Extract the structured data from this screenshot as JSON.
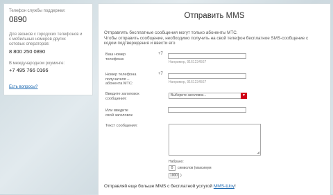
{
  "support": {
    "phone_label": "Телефон службы поддержки:",
    "short_number": "0890",
    "landline_note": "Для звонков с городских телефонов и с мобильных номеров других сотовых операторов:",
    "landline_lines": [
      "Для звонков с городских телефонов и",
      "с мобильных номеров других",
      "сотовых операторов:"
    ],
    "landline_number": "8 800 250 0890",
    "roaming_label": "В международном роуминге:",
    "roaming_number": "+7 495 766 0166",
    "questions_link": "Есть вопросы?"
  },
  "form": {
    "title": "Отправить MMS",
    "intro_line1": "Отправлять бесплатные сообщения могут только абоненты МТС.",
    "intro_line2": "Чтобы отправить сообщение, необходимо получить на свой телефон бесплатное SMS-сообщение с",
    "intro_line3": "кодом подтверждения и ввести его",
    "sender": {
      "label_line1": "Ваш номер",
      "label_line2": "телефона:",
      "prefix": "+7",
      "value": "",
      "hint": "Например, 9161234567"
    },
    "recipient": {
      "label_line1": "Номер телефона",
      "label_line2": "получателя –",
      "label_line3": "абонента МТС:",
      "prefix": "+7",
      "value": "",
      "hint": "Например, 9161234567"
    },
    "subject_select": {
      "label_line1": "Введите заголовок",
      "label_line2": "сообщения:",
      "selected": "Выберите заголовок..."
    },
    "custom_subject": {
      "label_line1": "Или введите",
      "label_line2": "свой заголовок",
      "value": ""
    },
    "message": {
      "label": "Текст сообщения:",
      "value": ""
    },
    "counter": {
      "typed_label": "Набрано:",
      "typed_value": "0",
      "suffix": "символов (максимум",
      "max_value": "1000",
      "close": ")"
    },
    "footer_text": "Отправляй еще больше MMS с бесплатной услугой ",
    "footer_link": "MMS-Шоу",
    "footer_end": "!"
  },
  "colors": {
    "accent_red": "#d00015",
    "link_blue": "#1a67b0"
  },
  "icons": {
    "dropdown": "chevron-down-icon",
    "resize": "resize-grip-icon"
  }
}
